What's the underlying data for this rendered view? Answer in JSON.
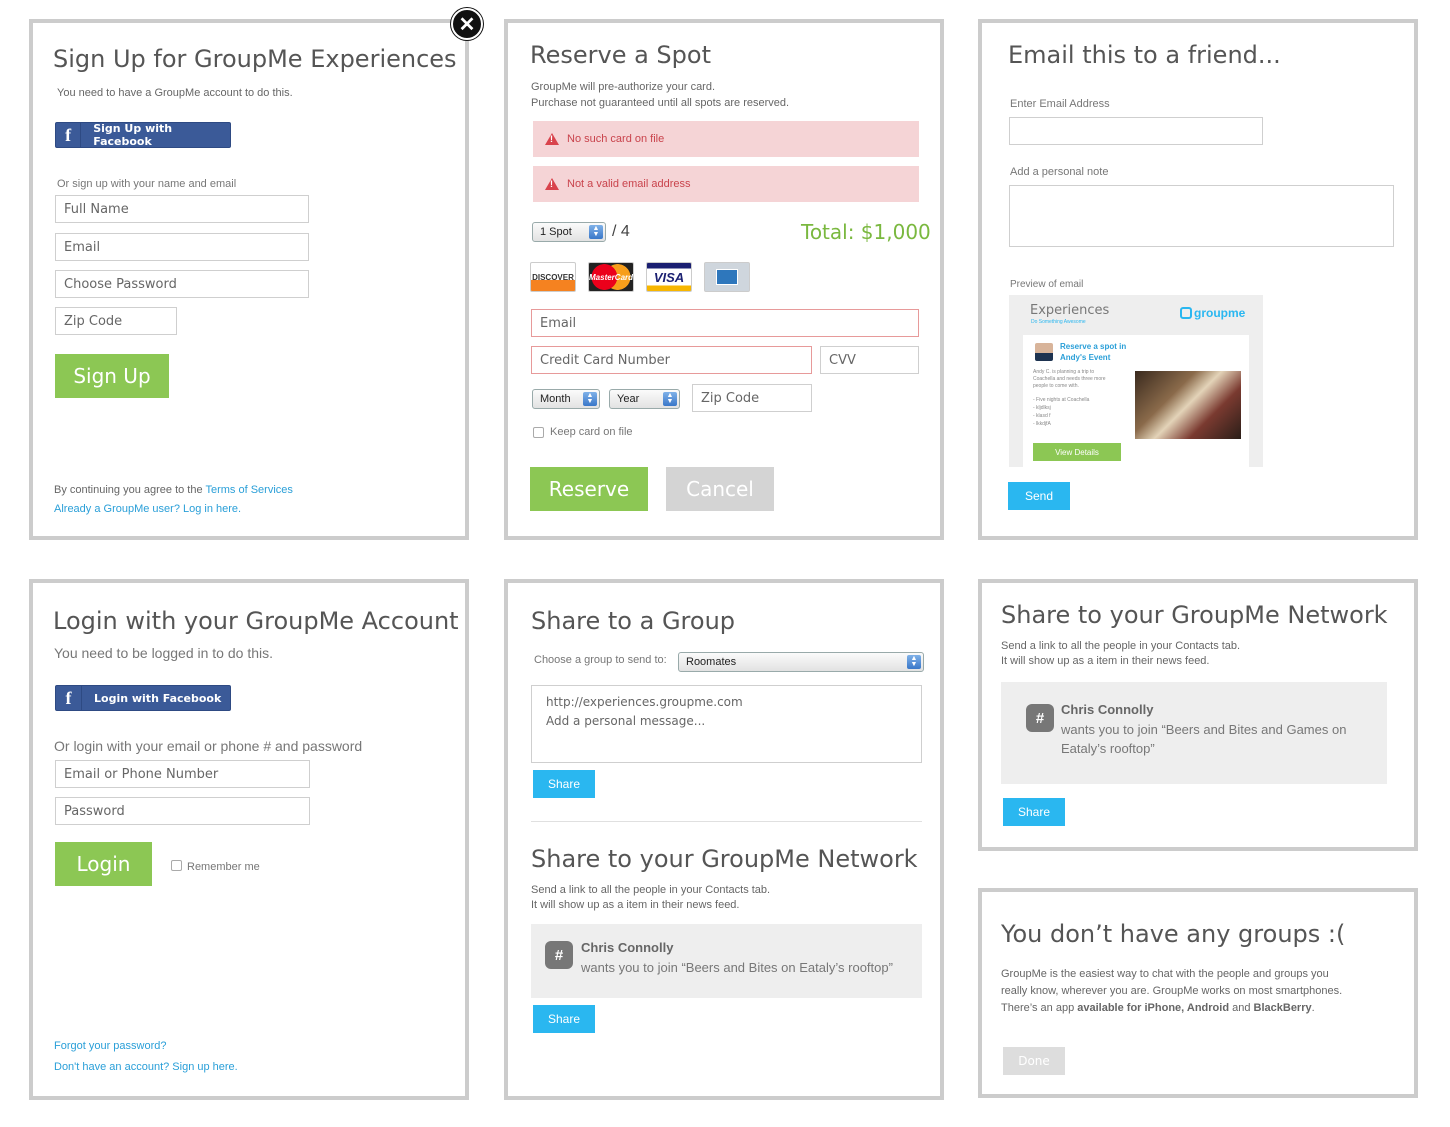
{
  "signup": {
    "title": "Sign Up for GroupMe Experiences",
    "subtitle": "You need to have a GroupMe account to do this.",
    "fb_button": "Sign Up with Facebook",
    "or_text": "Or sign up with your name and email",
    "full_name_placeholder": "Full Name",
    "email_placeholder": "Email",
    "password_placeholder": "Choose Password",
    "zip_placeholder": "Zip Code",
    "submit": "Sign Up",
    "terms_prefix": "By continuing you agree to the ",
    "terms_link": "Terms of Services",
    "login_link": "Already a GroupMe user? Log in here."
  },
  "reserve": {
    "title": "Reserve a Spot",
    "line1": "GroupMe will pre-authorize your card.",
    "line2": "Purchase not guaranteed until all spots are reserved.",
    "error1": "No such card on file",
    "error2": "Not a valid email address",
    "spots_select": "1 Spot",
    "spots_total": "/ 4",
    "total": "Total: $1,000",
    "cards": [
      "DISCOVER",
      "MasterCard",
      "VISA",
      "AMEX"
    ],
    "email_placeholder": "Email",
    "cc_placeholder": "Credit Card Number",
    "cvv_placeholder": "CVV",
    "month": "Month",
    "year": "Year",
    "zip_placeholder": "Zip Code",
    "keep_card": "Keep card on file",
    "reserve_btn": "Reserve",
    "cancel_btn": "Cancel"
  },
  "email_friend": {
    "title": "Email this to a friend...",
    "email_label": "Enter Email Address",
    "note_label": "Add a personal note",
    "preview_label": "Preview of email",
    "preview_brand": "Experiences",
    "preview_brand_sub": "Do Something Awesome",
    "preview_logo": "groupme",
    "preview_heading_1": "Reserve a spot in",
    "preview_heading_2": "Andy's Event",
    "preview_body": "Andy C. is planning a trip to Coachella and needs three more people to come with.",
    "preview_bullets": [
      "- Five nights at Coachella",
      "- kljdlksj",
      "- klasd f",
      "- lkkdjfA"
    ],
    "preview_btn": "View Details",
    "send_btn": "Send"
  },
  "login": {
    "title": "Login with your GroupMe Account",
    "subtitle": "You need to be logged in to do this.",
    "fb_button": "Login with Facebook",
    "or_text": "Or login with your email or phone # and password",
    "email_placeholder": "Email or Phone Number",
    "password_placeholder": "Password",
    "submit": "Login",
    "remember": "Remember me",
    "forgot_link": "Forgot your password?",
    "signup_link": "Don't have an account? Sign up here."
  },
  "share_group": {
    "title": "Share to a Group",
    "choose_label": "Choose a group to send to:",
    "group_select": "Roomates",
    "message_line1": "http://experiences.groupme.com",
    "message_line2": "Add a personal message...",
    "share_btn": "Share"
  },
  "share_network_mid": {
    "title": "Share to your GroupMe Network",
    "line1": "Send a link to all the people in your Contacts tab.",
    "line2": "It will show up as a item in their news feed.",
    "name": "Chris Connolly",
    "message": "wants you to join “Beers and Bites on Eataly’s rooftop”",
    "share_btn": "Share"
  },
  "share_network_right": {
    "title": "Share to your GroupMe Network",
    "line1": "Send a link to all the people in your Contacts tab.",
    "line2": "It will show up as a item in their news feed.",
    "name": "Chris Connolly",
    "message_line1": "wants you to join “Beers and Bites and Games on",
    "message_line2": "Eataly’s rooftop”",
    "share_btn": "Share"
  },
  "no_groups": {
    "title": "You don’t have any groups :(",
    "line1": "GroupMe is the easiest way to chat with the people and groups you",
    "line2": "really know, wherever you are. GroupMe works on most smartphones.",
    "line3_prefix": "There’s an app ",
    "line3_bold1": "available for iPhone, Android",
    "line3_mid": " and ",
    "line3_bold2": "BlackBerry",
    "line3_suffix": ".",
    "done_btn": "Done"
  },
  "colors": {
    "green": "#8cc754",
    "blue": "#2ab7f0",
    "facebook": "#3b5a98",
    "error_bg": "#f5d4d6",
    "error_text": "#c9434c",
    "border": "#cccccc"
  },
  "icons": {
    "close": "close-icon",
    "facebook": "facebook-icon",
    "warning": "warning-icon",
    "groupme": "groupme-icon"
  }
}
